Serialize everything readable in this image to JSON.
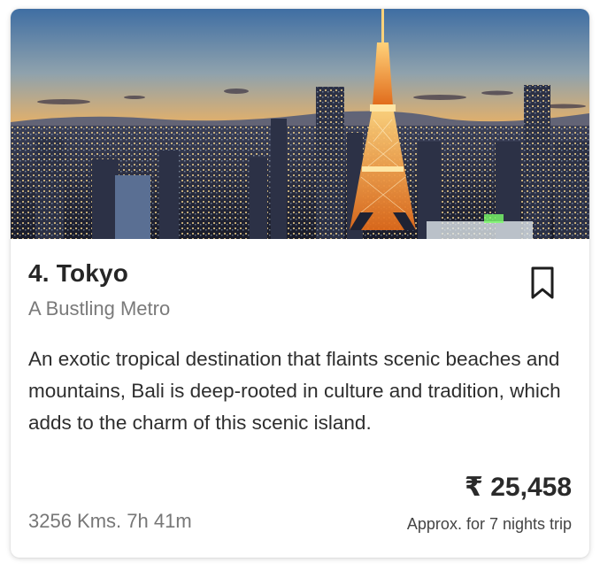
{
  "card": {
    "image": {
      "subject": "Tokyo skyline at sunset with illuminated Tokyo Tower"
    },
    "title": "4. Tokyo",
    "subtitle": "A Bustling Metro",
    "bookmark": {
      "icon": "bookmark-icon"
    },
    "description": "An exotic tropical destination that flaints scenic beaches and mountains, Bali is deep-rooted in culture and tradition, which adds to the charm of this scenic island.",
    "price": "₹ 25,458",
    "distance": "3256 Kms. 7h 41m",
    "price_note": "Approx. for 7 nights trip"
  },
  "colors": {
    "title": "#262626",
    "subtitle": "#7a7a7a",
    "accent_tower": "#f3a23a",
    "card_bg": "#ffffff"
  }
}
